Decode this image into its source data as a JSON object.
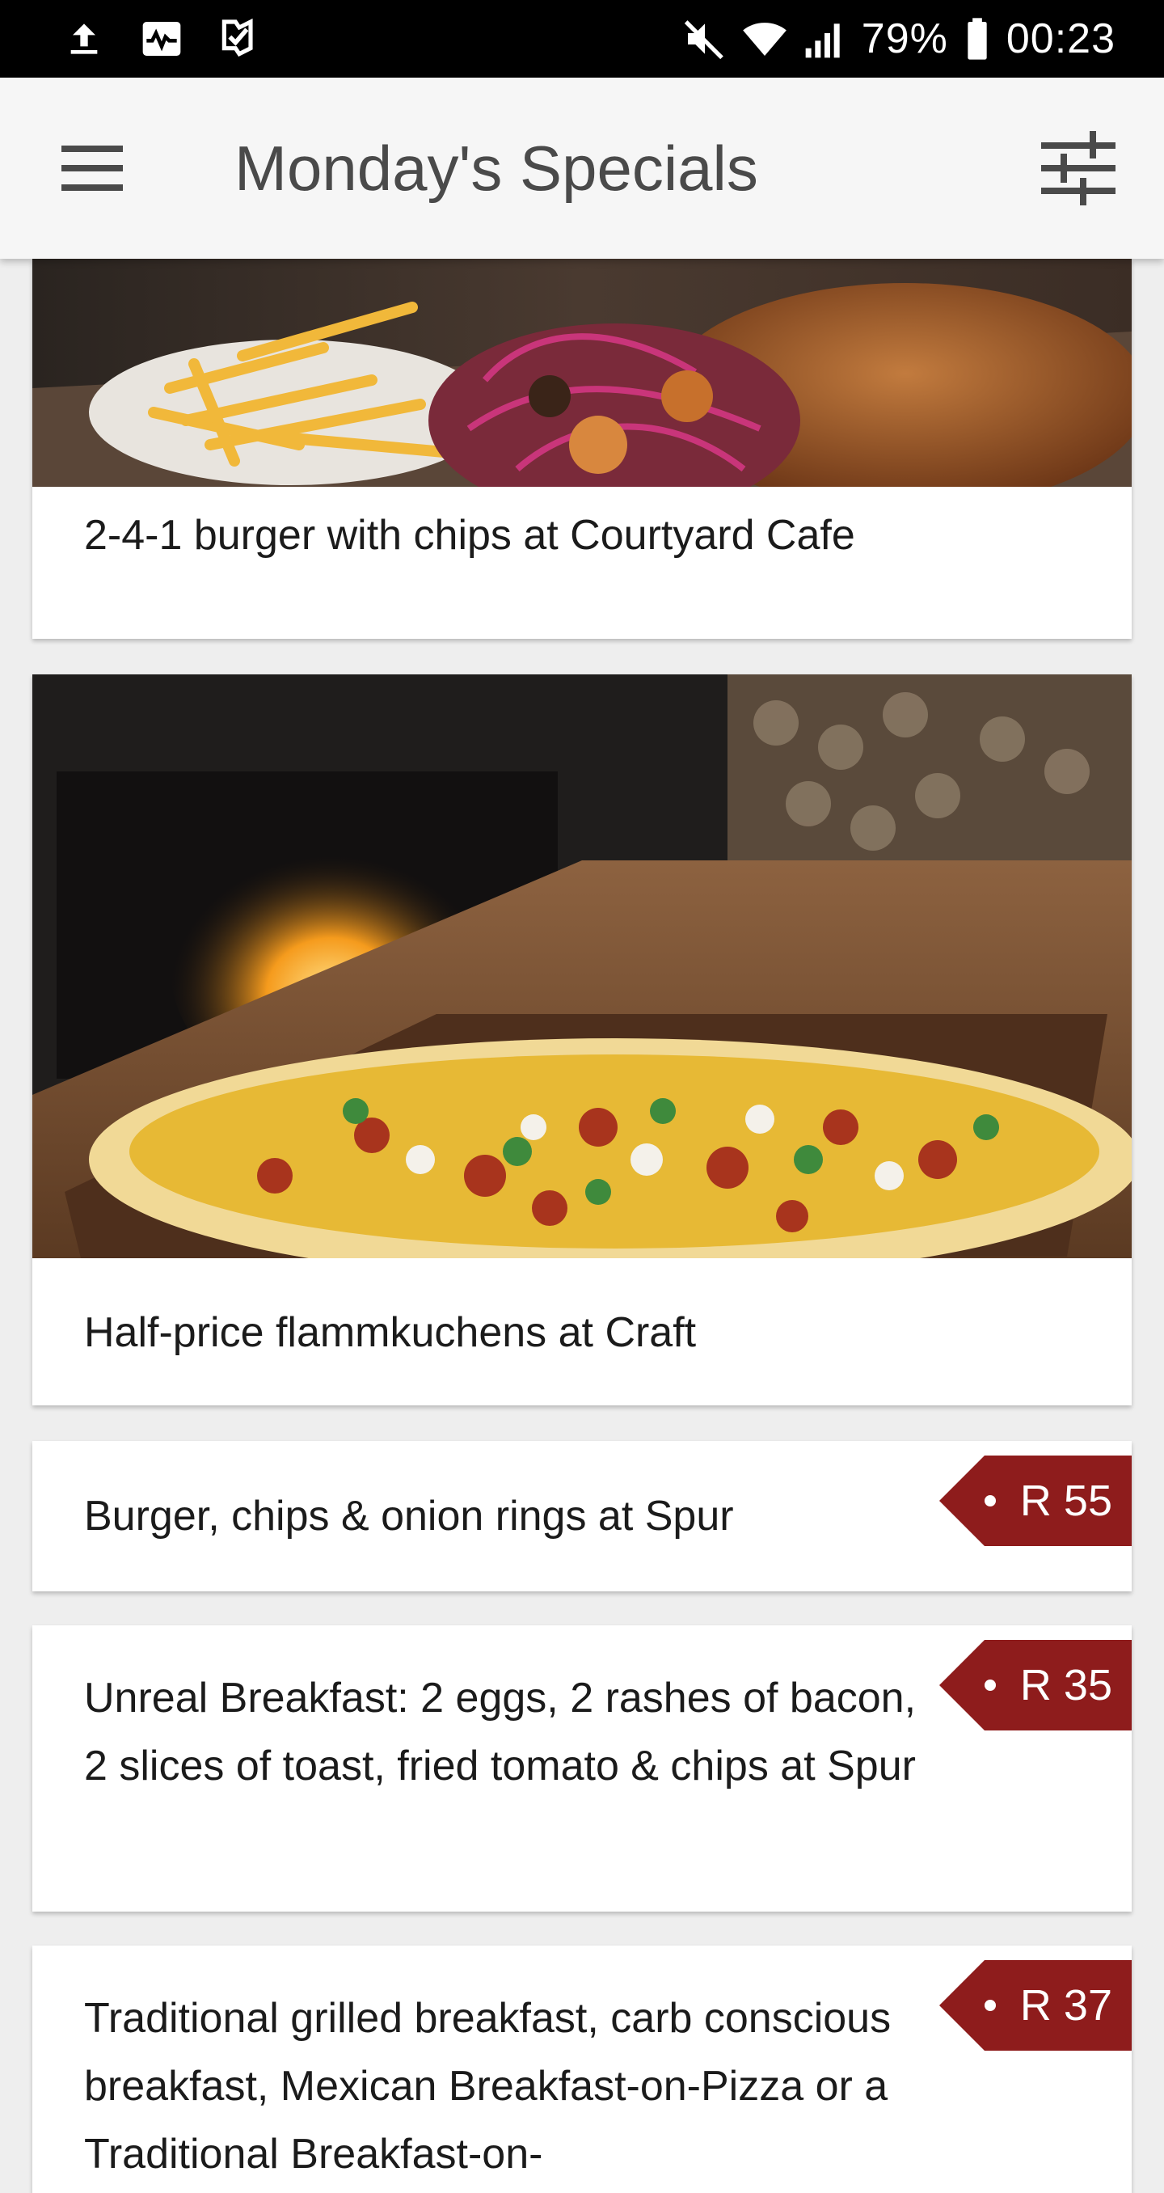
{
  "status_bar": {
    "battery_percent": "79%",
    "time": "00:23",
    "left_icons": [
      "upload-icon",
      "activity-icon",
      "checkmark-flag-icon"
    ],
    "right_icons": [
      "mute-icon",
      "wifi-icon",
      "signal-icon",
      "battery-icon"
    ]
  },
  "app_bar": {
    "title": "Monday's Specials",
    "menu_icon": "hamburger-menu-icon",
    "filter_icon": "sliders-filter-icon",
    "background": "#f6f6f6"
  },
  "cards": [
    {
      "title": "2-4-1 burger with chips at Courtyard Cafe",
      "image": "burger-with-chips-photo"
    },
    {
      "title": "Half-price flammkuchens at Craft",
      "image": "flammkuchen-by-fireplace-photo"
    },
    {
      "title": "Burger, chips & onion rings at Spur",
      "price": "R 55"
    },
    {
      "title": "Unreal Breakfast: 2 eggs, 2 rashes of bacon, 2 slices of toast, fried tomato & chips at Spur",
      "price": "R 35"
    },
    {
      "title": "Traditional grilled breakfast, carb conscious breakfast, Mexican Breakfast-on-Pizza or a Traditional Breakfast-on-",
      "price": "R 37"
    }
  ],
  "colors": {
    "price_tag": "#8e1c1c",
    "status_bar": "#000000",
    "feed_background": "#eeeeee"
  }
}
